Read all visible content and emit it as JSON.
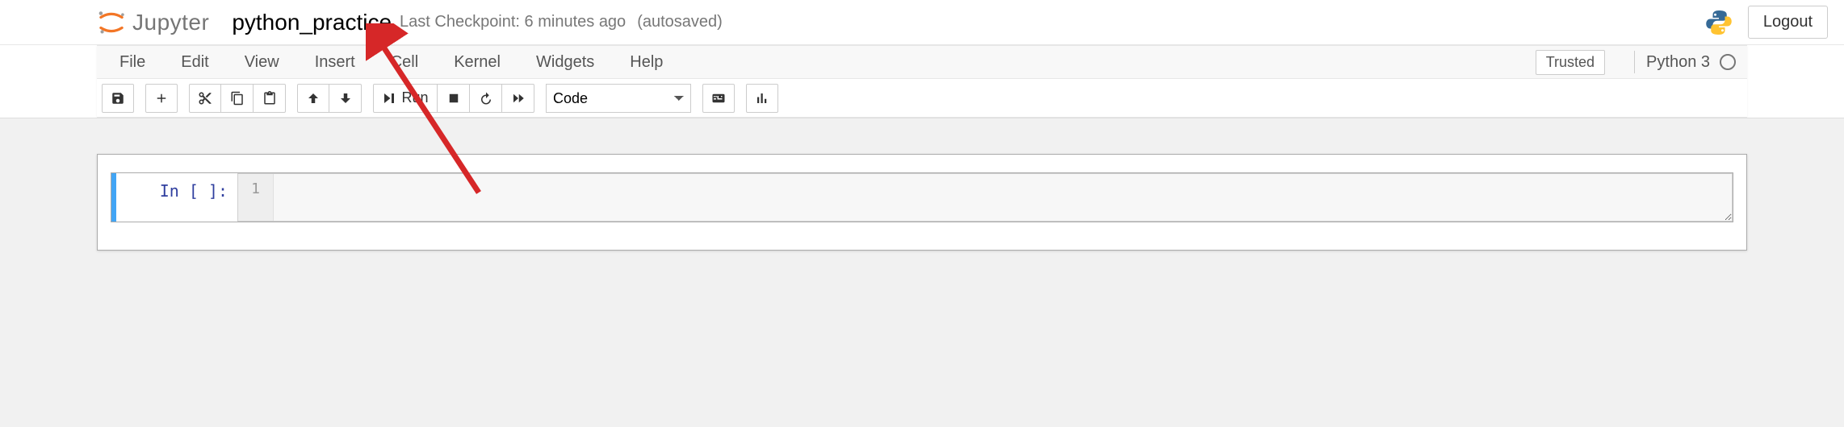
{
  "header": {
    "logo_text": "Jupyter",
    "notebook_name": "python_practice",
    "checkpoint_text": "Last Checkpoint: 6 minutes ago",
    "autosave_text": "(autosaved)",
    "logout_label": "Logout"
  },
  "menubar": {
    "items": [
      "File",
      "Edit",
      "View",
      "Insert",
      "Cell",
      "Kernel",
      "Widgets",
      "Help"
    ],
    "trusted_label": "Trusted",
    "kernel_name": "Python 3"
  },
  "toolbar": {
    "run_label": "Run",
    "cell_type_selected": "Code"
  },
  "cell": {
    "prompt": "In [ ]:",
    "line_number": "1",
    "code": ""
  },
  "colors": {
    "accent_blue": "#42A5F5",
    "jupyter_orange": "#F37626",
    "arrow_red": "#D62728"
  }
}
